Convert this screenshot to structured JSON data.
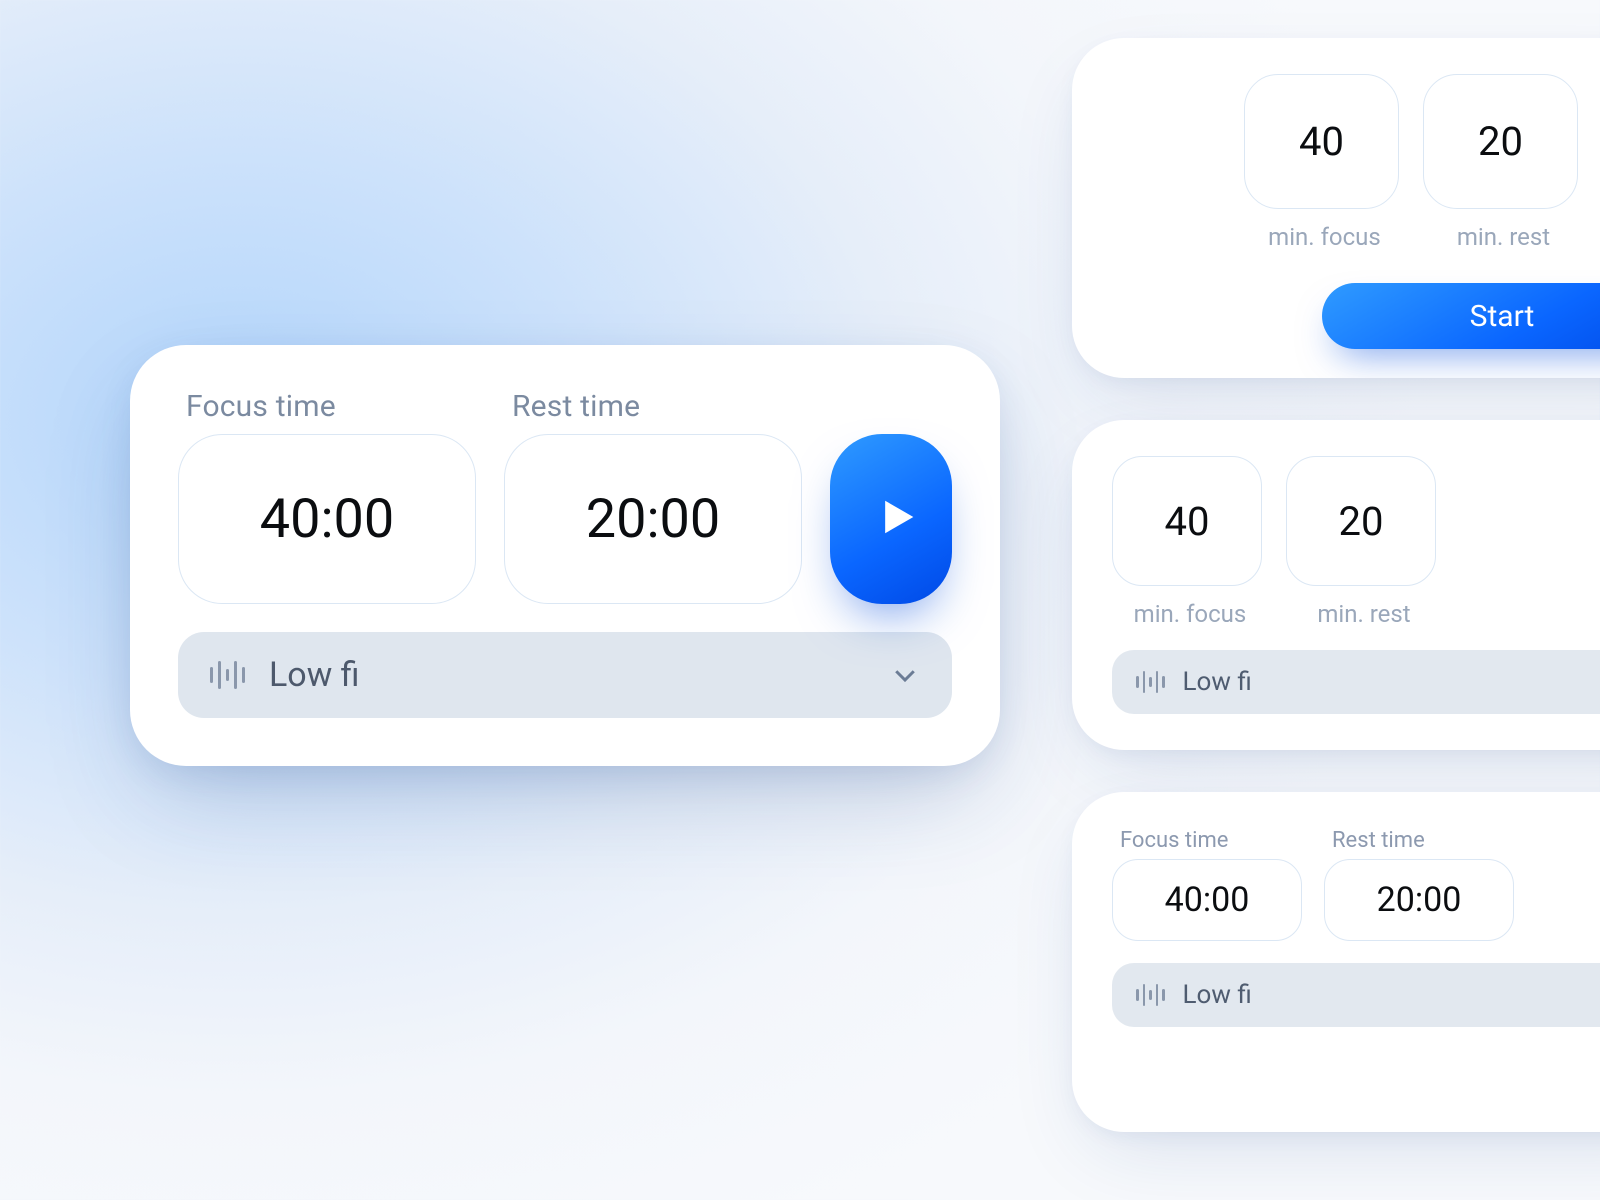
{
  "hero": {
    "focus_label": "Focus time",
    "rest_label": "Rest time",
    "focus_value": "40:00",
    "rest_value": "20:00",
    "sound_label": "Low fi"
  },
  "preview1": {
    "focus_value": "40",
    "rest_value": "20",
    "focus_label": "min. focus",
    "rest_label": "min. rest",
    "start_label": "Start"
  },
  "preview2": {
    "focus_value": "40",
    "rest_value": "20",
    "focus_label": "min. focus",
    "rest_label": "min. rest",
    "sound_label": "Low fi"
  },
  "preview3": {
    "focus_head": "Focus time",
    "rest_head": "Rest time",
    "focus_value": "40:00",
    "rest_value": "20:00",
    "sound_label": "Low fi"
  }
}
